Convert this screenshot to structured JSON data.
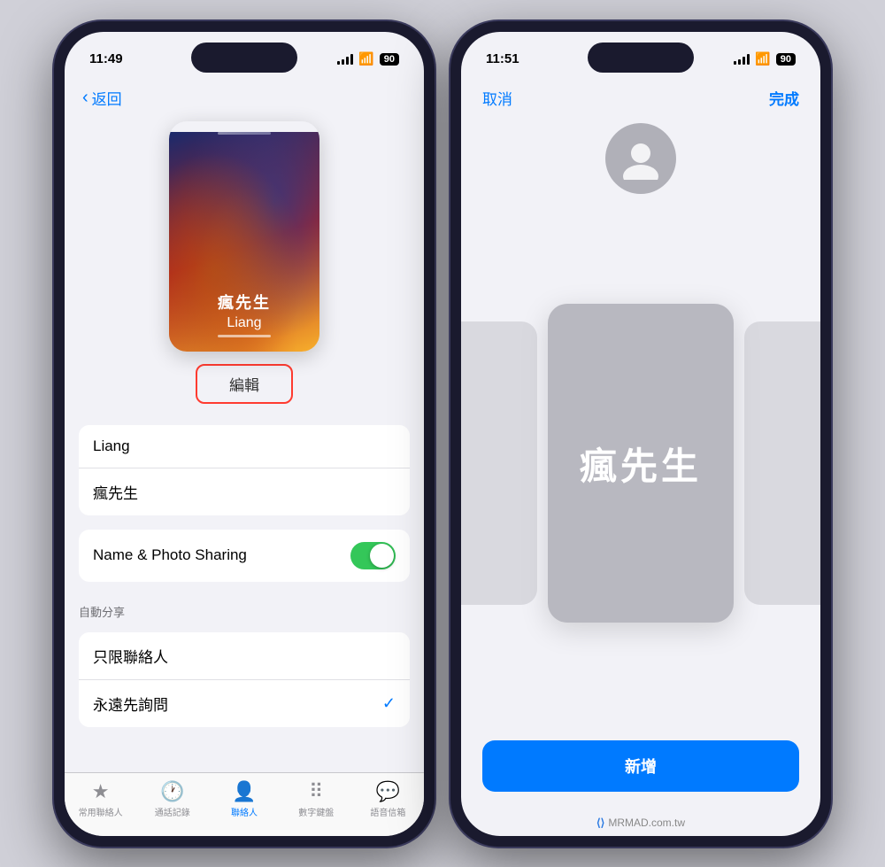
{
  "phone1": {
    "status": {
      "time": "11:49",
      "battery_icon": "🔋",
      "battery_level": "90",
      "wifi": "WiFi",
      "signal": "Signal"
    },
    "nav": {
      "back_label": "返回"
    },
    "card": {
      "name_cn": "瘋先生",
      "name_en": "Liang"
    },
    "edit_button_label": "編輯",
    "fields": [
      {
        "value": "Liang"
      },
      {
        "value": "瘋先生"
      }
    ],
    "sharing_section": {
      "toggle_label": "Name & Photo Sharing",
      "toggle_on": true
    },
    "auto_share_header": "自動分享",
    "auto_share_options": [
      {
        "label": "只限聯絡人",
        "checked": false
      },
      {
        "label": "永遠先詢問",
        "checked": true
      }
    ],
    "tabs": [
      {
        "icon": "★",
        "label": "常用聯絡人",
        "active": false
      },
      {
        "icon": "🕐",
        "label": "通話記錄",
        "active": false
      },
      {
        "icon": "👤",
        "label": "聯絡人",
        "active": true
      },
      {
        "icon": "⠿",
        "label": "數字鍵盤",
        "active": false
      },
      {
        "icon": "💬",
        "label": "語音信箱",
        "active": false
      }
    ]
  },
  "phone2": {
    "status": {
      "time": "11:51",
      "battery_level": "90"
    },
    "nav": {
      "cancel_label": "取消",
      "done_label": "完成"
    },
    "poster_text": "瘋先生",
    "add_button_label": "新增",
    "watermark": "MRMAD.com.tw"
  }
}
